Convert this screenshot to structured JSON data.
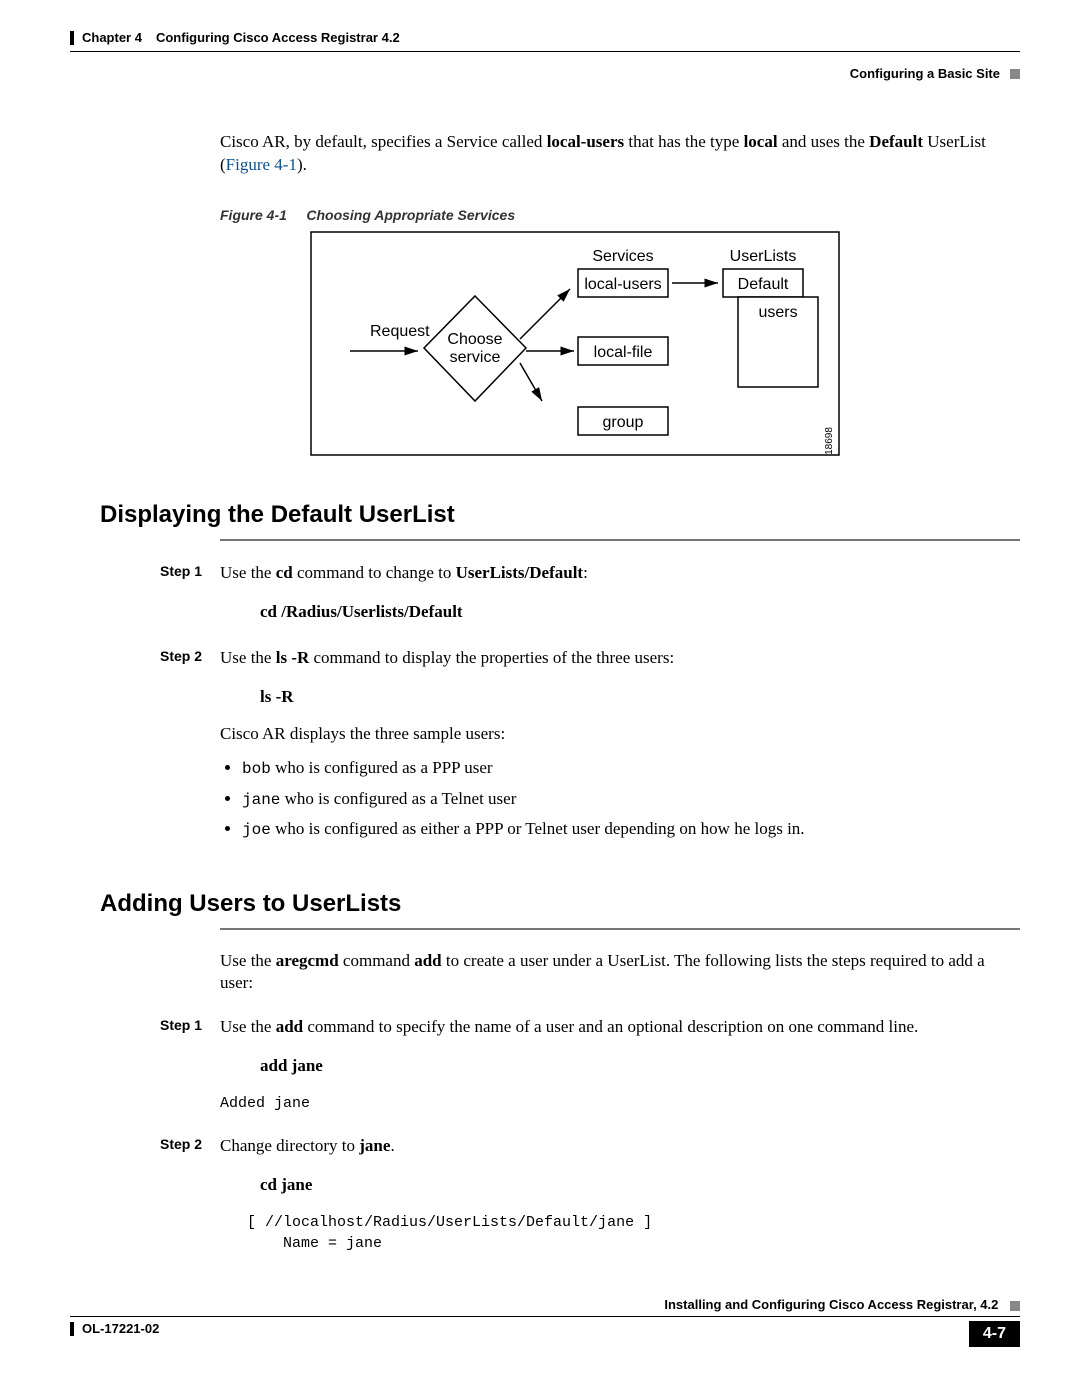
{
  "header": {
    "chapter_label": "Chapter 4",
    "chapter_title": "Configuring Cisco Access Registrar 4.2",
    "section_title": "Configuring a Basic Site"
  },
  "intro": {
    "text_prefix": "Cisco AR, by default, specifies a Service called ",
    "bold1": "local-users",
    "text_mid1": " that has the type ",
    "bold2": "local",
    "text_mid2": " and uses the ",
    "bold3": "Default",
    "text_end1": " UserList (",
    "figure_ref": "Figure 4-1",
    "text_end2": ")."
  },
  "figure": {
    "caption_label": "Figure 4-1",
    "caption_title": "Choosing Appropriate Services",
    "labels": {
      "request": "Request",
      "choose_service_l1": "Choose",
      "choose_service_l2": "service",
      "services": "Services",
      "local_users": "local-users",
      "local_file": "local-file",
      "group": "group",
      "userlists": "UserLists",
      "default": "Default",
      "users": "users",
      "id": "18698"
    }
  },
  "section1": {
    "heading": "Displaying the Default UserList",
    "step1": {
      "label": "Step 1",
      "t1": "Use the ",
      "b1": "cd",
      "t2": " command to change to ",
      "b2": "UserLists/Default",
      "t3": ":",
      "cmd": "cd /Radius/Userlists/Default"
    },
    "step2": {
      "label": "Step 2",
      "t1": "Use the ",
      "b1": "ls -R",
      "t2": " command to display the properties of the three users:",
      "cmd": "ls -R"
    },
    "display_intro": "Cisco AR displays the three sample users:",
    "bullets": [
      {
        "code": "bob",
        "text": " who is configured as a PPP user"
      },
      {
        "code": "jane",
        "text": " who is configured as a Telnet user"
      },
      {
        "code": "joe",
        "text": " who is configured as either a PPP or Telnet user depending on how he logs in."
      }
    ]
  },
  "section2": {
    "heading": "Adding Users to UserLists",
    "intro": {
      "t1": "Use the ",
      "b1": "aregcmd",
      "t2": " command ",
      "b2": "add",
      "t3": " to create a user under a UserList. The following lists the steps required to add a user:"
    },
    "step1": {
      "label": "Step 1",
      "t1": "Use the ",
      "b1": "add",
      "t2": " command to specify the name of a user and an optional description on one command line.",
      "cmd": "add jane",
      "output": "Added jane"
    },
    "step2": {
      "label": "Step 2",
      "t1": "Change directory to ",
      "b1": "jane",
      "t2": ".",
      "cmd": "cd jane",
      "output": "   [ //localhost/Radius/UserLists/Default/jane ]\n       Name = jane"
    }
  },
  "footer": {
    "book_title": "Installing and Configuring Cisco Access Registrar, 4.2",
    "doc_id": "OL-17221-02",
    "page_num": "4-7"
  }
}
